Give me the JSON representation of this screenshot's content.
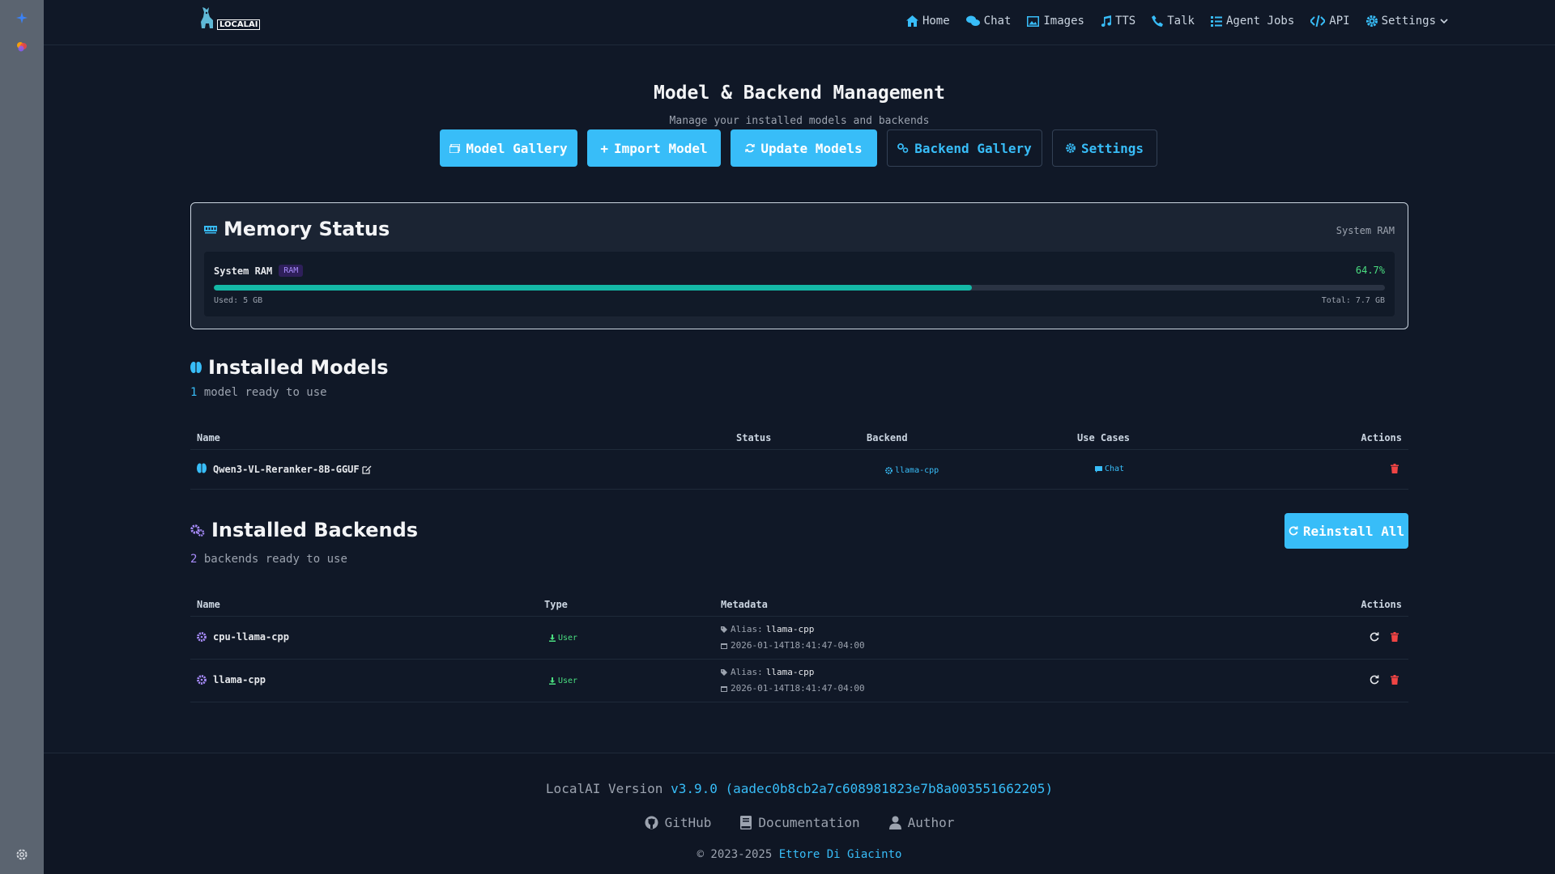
{
  "colors": {
    "accent": "#38bdf8",
    "bg": "#101827",
    "progress": "#14b8a6",
    "success": "#4ade80",
    "danger": "#ef4444",
    "purple": "#a78bfa"
  },
  "logo": {
    "text": "LOCALAI"
  },
  "nav": {
    "home": "Home",
    "chat": "Chat",
    "images": "Images",
    "tts": "TTS",
    "talk": "Talk",
    "agent_jobs": "Agent Jobs",
    "api": "API",
    "settings": "Settings"
  },
  "page": {
    "title": "Model & Backend Management",
    "subtitle": "Manage your installed models and backends"
  },
  "buttons": {
    "model_gallery": "Model Gallery",
    "import_model": "Import Model",
    "update_models": "Update Models",
    "backend_gallery": "Backend Gallery",
    "settings": "Settings",
    "reinstall_all": "Reinstall All"
  },
  "memory": {
    "title": "Memory Status",
    "right_label": "System RAM",
    "label": "System RAM",
    "badge": "RAM",
    "percent_text": "64.7%",
    "percent": 64.7,
    "used": "Used: 5 GB",
    "total": "Total: 7.7 GB"
  },
  "models": {
    "title": "Installed Models",
    "count": "1",
    "count_text": "model ready to use",
    "columns": {
      "name": "Name",
      "status": "Status",
      "backend": "Backend",
      "use_cases": "Use Cases",
      "actions": "Actions"
    },
    "rows": [
      {
        "name": "Qwen3-VL-Reranker-8B-GGUF",
        "status": "",
        "backend": "llama-cpp",
        "use_case": "Chat"
      }
    ]
  },
  "backends": {
    "title": "Installed Backends",
    "count": "2",
    "count_text": "backends ready to use",
    "columns": {
      "name": "Name",
      "type": "Type",
      "metadata": "Metadata",
      "actions": "Actions"
    },
    "alias_label": "Alias:",
    "rows": [
      {
        "name": "cpu-llama-cpp",
        "type": "User",
        "alias": "llama-cpp",
        "date": "2026-01-14T18:41:47-04:00"
      },
      {
        "name": "llama-cpp",
        "type": "User",
        "alias": "llama-cpp",
        "date": "2026-01-14T18:41:47-04:00"
      }
    ]
  },
  "footer": {
    "version_label": "LocalAI Version",
    "version": "v3.9.0 (aadec0b8cb2a7c608981823e7b8a003551662205)",
    "github": "GitHub",
    "documentation": "Documentation",
    "author": "Author",
    "copyright": "© 2023-2025",
    "author_name": "Ettore Di Giacinto"
  }
}
